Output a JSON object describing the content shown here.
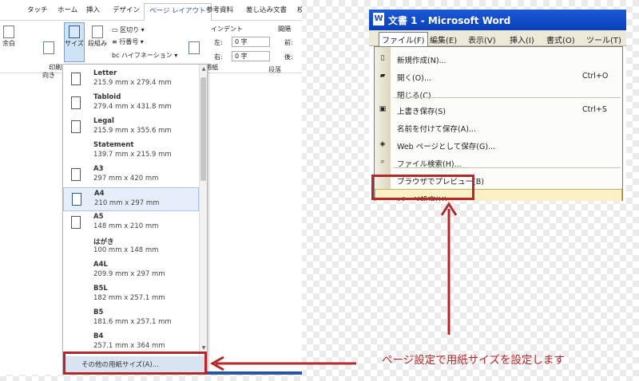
{
  "ribbon": {
    "tabs": [
      "タッチ",
      "ホーム",
      "挿入",
      "デザイン",
      "ページ レイアウト",
      "参考資料",
      "差し込み文書",
      "校"
    ],
    "buttons": {
      "margin": "余白",
      "orientation": "印刷の\n向き",
      "size": "サイズ",
      "columns": "段組み",
      "breaks": "区切り",
      "line_numbers": "行番号",
      "hyphenation": "ハイフネーション",
      "draft_paper": "原稿用紙\n設定"
    },
    "indent": {
      "heading": "インデント",
      "left_label": "左:",
      "left_value": "0 字",
      "right_label": "右:",
      "right_value": "0 字"
    },
    "spacing": {
      "heading": "間隔",
      "before": "前:",
      "after": "後:"
    },
    "paragraph_group": "段落"
  },
  "paper_sizes": [
    {
      "name": "Letter",
      "dim": "215.9 mm x 279.4 mm",
      "icon": true,
      "selected": false
    },
    {
      "name": "Tabloid",
      "dim": "279.4 mm x 431.8 mm",
      "icon": true,
      "selected": false
    },
    {
      "name": "Legal",
      "dim": "215.9 mm x 355.6 mm",
      "icon": true,
      "selected": false
    },
    {
      "name": "Statement",
      "dim": "139.7 mm x 215.9 mm",
      "icon": false,
      "selected": false
    },
    {
      "name": "A3",
      "dim": "297 mm x 420 mm",
      "icon": true,
      "selected": false
    },
    {
      "name": "A4",
      "dim": "210 mm x 297 mm",
      "icon": true,
      "selected": true
    },
    {
      "name": "A5",
      "dim": "148 mm x 210 mm",
      "icon": true,
      "selected": false
    },
    {
      "name": "はがき",
      "dim": "100 mm x 148 mm",
      "icon": false,
      "selected": false
    },
    {
      "name": "A4L",
      "dim": "209.9 mm x 297 mm",
      "icon": false,
      "selected": false
    },
    {
      "name": "B5L",
      "dim": "182 mm x 257.1 mm",
      "icon": false,
      "selected": false
    },
    {
      "name": "B5",
      "dim": "181.6 mm x 257.1 mm",
      "icon": false,
      "selected": false
    },
    {
      "name": "B4",
      "dim": "257.1 mm x 364 mm",
      "icon": false,
      "selected": false
    }
  ],
  "more_sizes": "その他の用紙サイズ(A)...",
  "word2003": {
    "title": "文書 1 - Microsoft Word",
    "title_icon": "W",
    "menus": [
      "ファイル(F)",
      "編集(E)",
      "表示(V)",
      "挿入(I)",
      "書式(O)",
      "ツール(T)"
    ],
    "items": [
      {
        "label": "新規作成(N)...",
        "shortcut": "",
        "icon": "new-document-icon"
      },
      {
        "label": "開く(O)...",
        "shortcut": "Ctrl+O",
        "icon": "open-folder-icon"
      },
      {
        "label": "閉じる(C)",
        "shortcut": "",
        "icon": ""
      },
      {
        "label": "上書き保存(S)",
        "shortcut": "Ctrl+S",
        "icon": "save-disk-icon"
      },
      {
        "label": "名前を付けて保存(A)...",
        "shortcut": "",
        "icon": ""
      },
      {
        "label": "Web ページとして保存(G)...",
        "shortcut": "",
        "icon": "web-page-icon"
      },
      {
        "label": "ファイル検索(H)...",
        "shortcut": "",
        "icon": "file-search-icon"
      },
      {
        "label": "ブラウザでプレビュー(B)",
        "shortcut": "",
        "icon": ""
      },
      {
        "label": "ページ設定(U)...",
        "shortcut": "",
        "icon": ""
      }
    ]
  },
  "caption": "ページ設定で用紙サイズを設定します",
  "colors": {
    "annotation_red": "#b3282d",
    "word_blue": "#2b579a"
  }
}
